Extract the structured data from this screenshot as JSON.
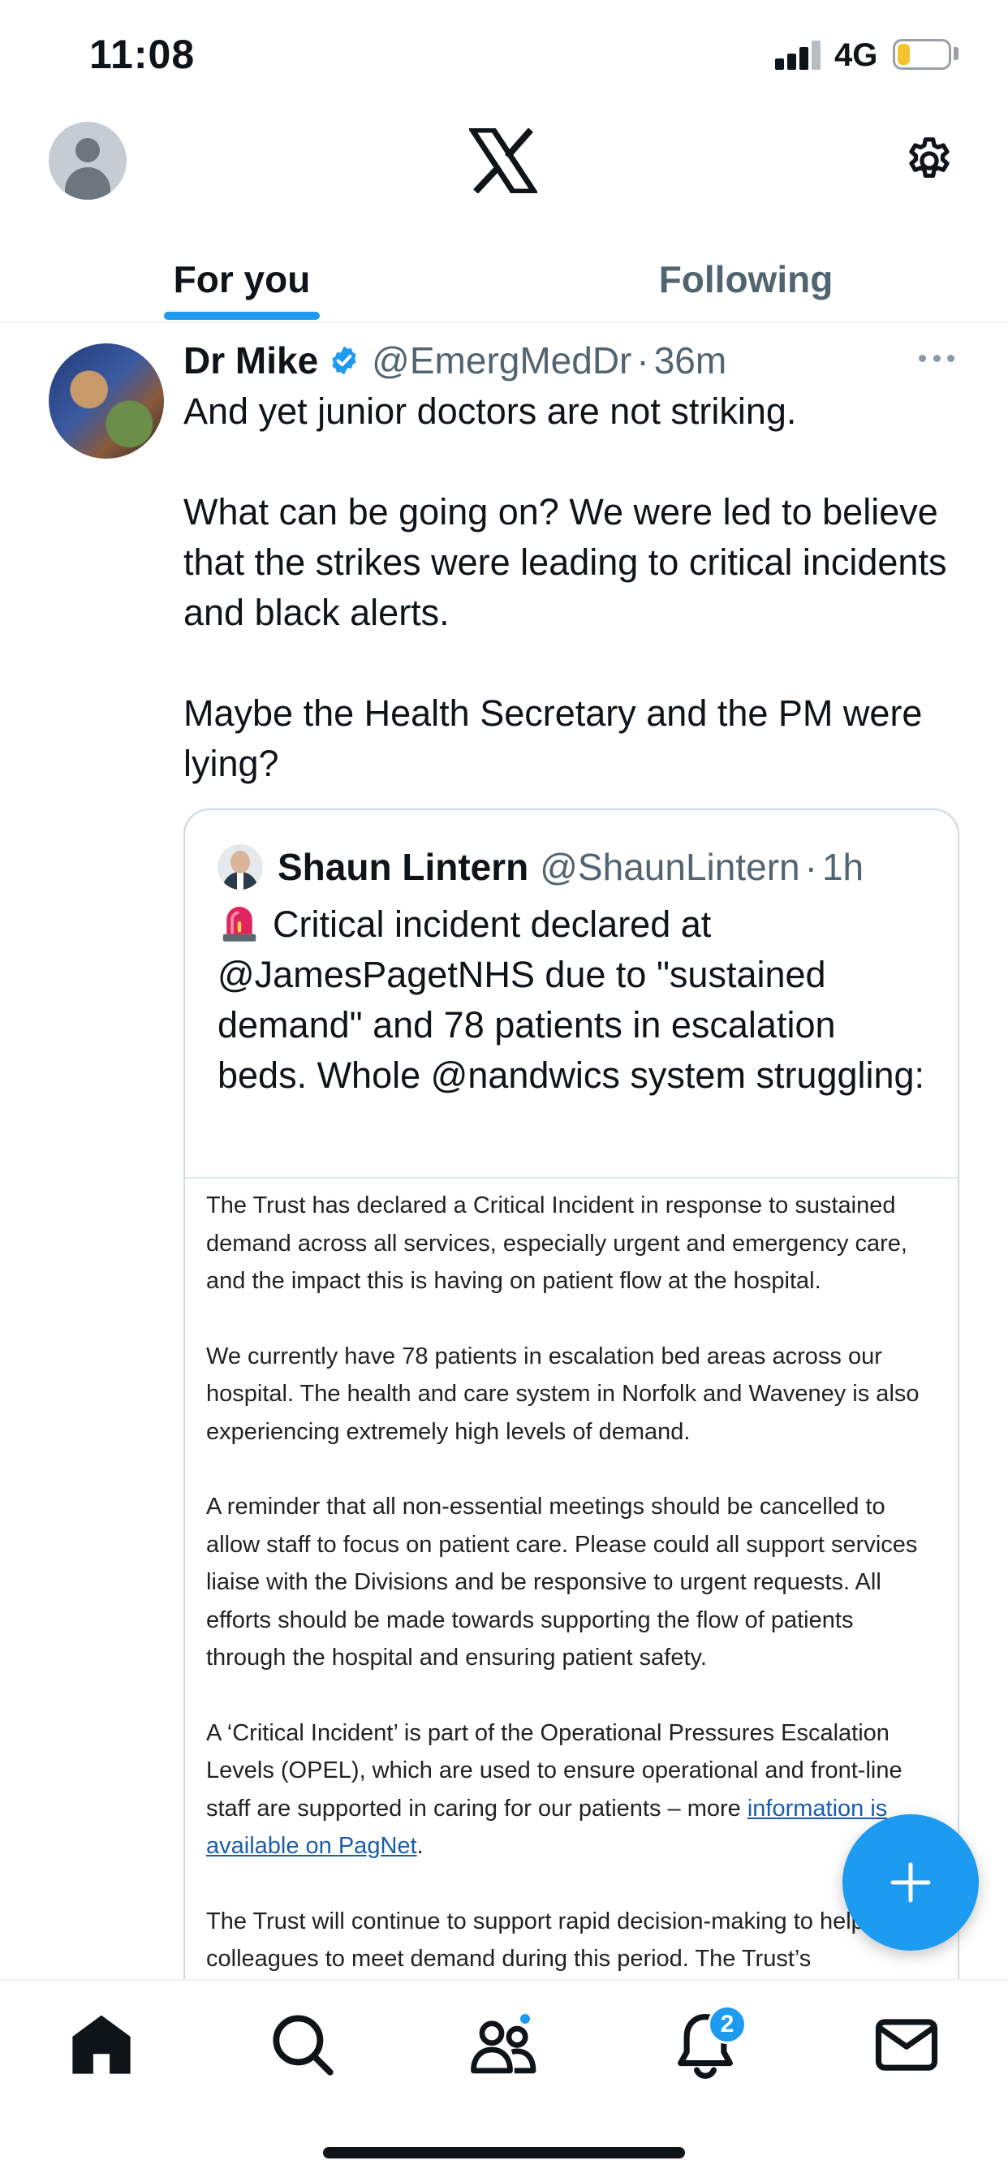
{
  "status_bar": {
    "time": "11:08",
    "network": "4G",
    "signal_bars_active": 3,
    "signal_bars_total": 4,
    "battery_level": 0.25,
    "battery_color": "#f4c430"
  },
  "header": {
    "logo": "x-logo",
    "tabs": [
      {
        "label": "For you",
        "active": true
      },
      {
        "label": "Following",
        "active": false
      }
    ]
  },
  "tweet": {
    "author_name": "Dr Mike",
    "verified": true,
    "handle": "@EmergMedDr",
    "separator": "·",
    "time": "36m",
    "paragraphs": [
      "And yet junior doctors are not striking.",
      "What can be going on? We were led to believe that the strikes were leading to critical incidents and black alerts.",
      "Maybe the Health Secretary and the PM were lying?"
    ],
    "quote": {
      "author_name": "Shaun Lintern",
      "handle": "@ShaunLintern",
      "separator": "·",
      "time": "1h",
      "emoji_icon": "police-siren-icon",
      "text": "Critical incident declared at @JamesPagetNHS due to \"sustained demand\" and 78 patients in escalation beds. Whole @nandwics system struggling:",
      "image_text": {
        "p1": "The Trust has declared a Critical Incident in response to sustained demand across all services, especially urgent and emergency care, and the impact this is having on patient flow at the hospital.",
        "p2": "We currently have 78 patients in escalation bed areas across our hospital. The health and care system in Norfolk and Waveney is also experiencing extremely high levels of demand.",
        "p3": "A reminder that all non-essential meetings should be cancelled to allow staff to focus on patient care. Please could all support services liaise with the Divisions and be responsive to urgent requests. All efforts should be made towards supporting the flow of patients through the hospital and ensuring patient safety.",
        "p4_text": "A ‘Critical Incident’ is part of the Operational Pressures Escalation Levels (OPEL), which are used to ensure operational and front-line staff are supported in caring for our patients – more ",
        "p4_link": "information is available on PagNet",
        "p4_end": ".",
        "p5": "The Trust will continue to support rapid decision-making to help colleagues to meet demand during this period. The Trust’s"
      }
    }
  },
  "fab": {
    "icon": "plus-icon",
    "color": "#1d9bf0"
  },
  "bottom_nav": {
    "items": [
      "home-icon",
      "search-icon",
      "communities-icon",
      "notifications-icon",
      "messages-icon"
    ],
    "notifications_badge": "2"
  },
  "colors": {
    "accent": "#1d9bf0",
    "text_primary": "#0f1419",
    "text_secondary": "#536471",
    "border": "#cfd9de"
  }
}
